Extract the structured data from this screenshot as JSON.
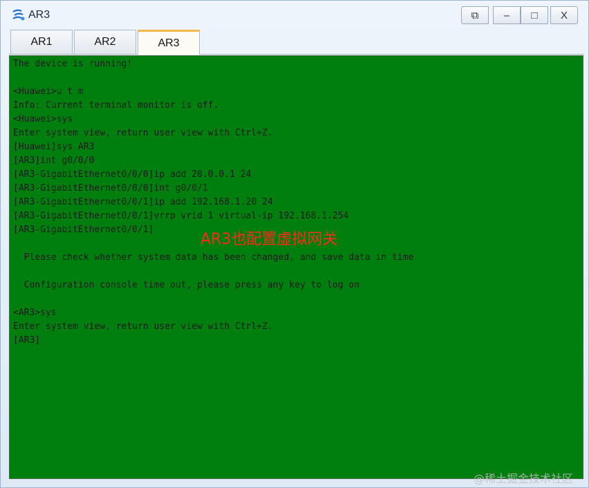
{
  "window": {
    "title": "AR3",
    "controls": {
      "restore": "⧉",
      "minimize": "–",
      "maximize": "□",
      "close": "X"
    }
  },
  "tabs": [
    {
      "label": "AR1",
      "active": false
    },
    {
      "label": "AR2",
      "active": false
    },
    {
      "label": "AR3",
      "active": true
    }
  ],
  "terminal": {
    "background": "#007f0e",
    "text_color": "#1c1c1c",
    "lines": [
      "The device is running!",
      "",
      "<Huawei>u t m",
      "Info: Current terminal monitor is off.",
      "<Huawei>sys",
      "Enter system view, return user view with Ctrl+Z.",
      "[Huawei]sys AR3",
      "[AR3]int g0/0/0",
      "[AR3-GigabitEthernet0/0/0]ip add 20.0.0.1 24",
      "[AR3-GigabitEthernet0/0/0]int g0/0/1",
      "[AR3-GigabitEthernet0/0/1]ip add 192.168.1.20 24",
      "[AR3-GigabitEthernet0/0/1]vrrp vrid 1 virtual-ip 192.168.1.254",
      "[AR3-GigabitEthernet0/0/1]",
      "",
      "  Please check whether system data has been changed, and save data in time",
      "",
      "  Configuration console time out, please press any key to log on",
      "",
      "<AR3>sys",
      "Enter system view, return user view with Ctrl+Z.",
      "[AR3]"
    ]
  },
  "annotation": {
    "text": "AR3也配置虚拟网关",
    "color": "#ff2a1a"
  },
  "watermark": "@稀土掘金技术社区"
}
